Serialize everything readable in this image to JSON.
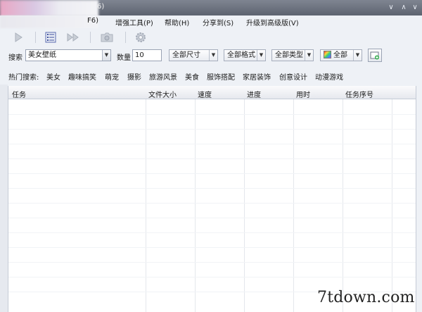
{
  "title": {
    "partial_visible": "6)"
  },
  "menu": {
    "items": [
      {
        "label": "增强工具(P)"
      },
      {
        "label": "帮助(H)"
      },
      {
        "label": "分享到(S)"
      },
      {
        "label": "升级到高级版(V)"
      }
    ],
    "partial_first": "F6)"
  },
  "toolbar": {
    "icons": [
      "play-icon",
      "list-icon",
      "fast-forward-icon",
      "camera-icon",
      "gear-icon"
    ]
  },
  "search": {
    "label": "搜索",
    "value": "美女壁纸",
    "count_label": "数量",
    "count_value": "10",
    "size_filter": "全部尺寸",
    "format_filter": "全部格式",
    "type_filter": "全部类型",
    "color_filter": "全部"
  },
  "hot": {
    "label": "热门搜索:",
    "items": [
      "美女",
      "趣味搞笑",
      "萌宠",
      "摄影",
      "旅游风景",
      "美食",
      "服饰搭配",
      "家居装饰",
      "创意设计",
      "动漫游戏"
    ]
  },
  "table": {
    "columns": [
      "任务",
      "文件大小",
      "速度",
      "进度",
      "用时",
      "任务序号"
    ]
  },
  "watermark": "7tdown.com",
  "colors": {
    "titlebar": "#6a707c",
    "panel": "#eef1f6",
    "table_bg": "#ffffff"
  }
}
